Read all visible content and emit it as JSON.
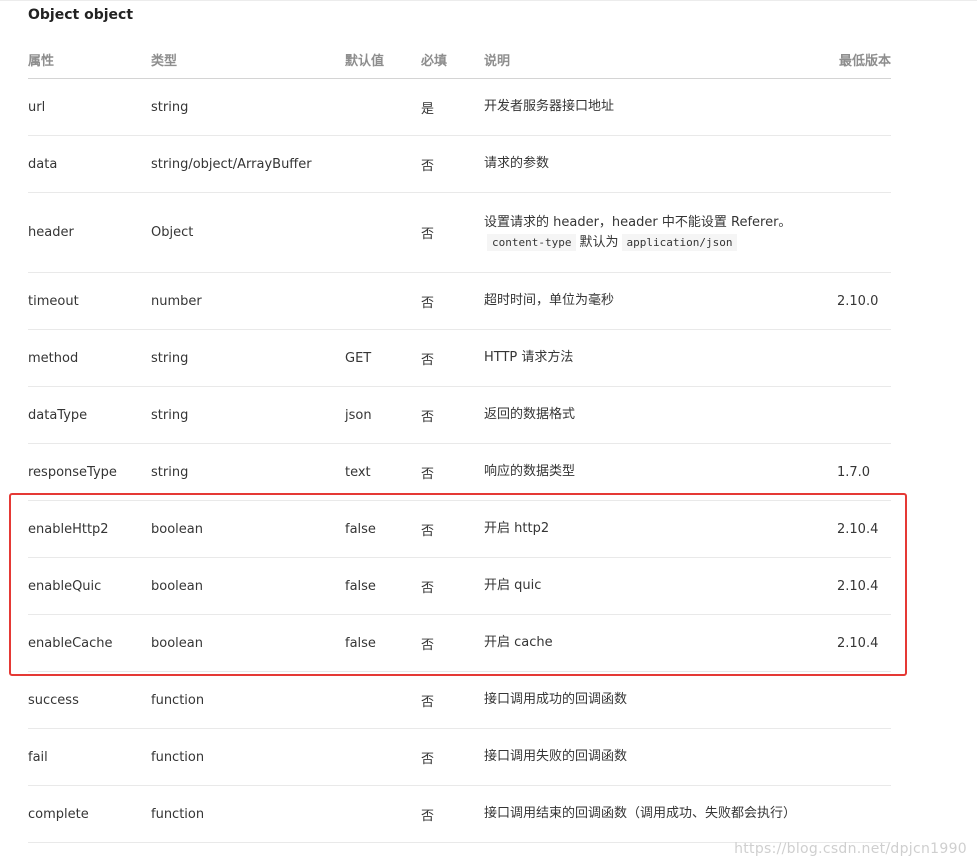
{
  "title": "Object object",
  "columns": [
    "属性",
    "类型",
    "默认值",
    "必填",
    "说明",
    "最低版本"
  ],
  "rows": [
    {
      "name": "url",
      "type": "string",
      "default": "",
      "required": "是",
      "desc": "开发者服务器接口地址",
      "version": ""
    },
    {
      "name": "data",
      "type": "string/object/ArrayBuffer",
      "default": "",
      "required": "否",
      "desc": "请求的参数",
      "version": ""
    },
    {
      "name": "header",
      "type": "Object",
      "default": "",
      "required": "否",
      "desc_line1": "设置请求的 header，header 中不能设置 Referer。",
      "desc_code1": "content-type",
      "desc_mid": "默认为",
      "desc_code2": "application/json",
      "version": ""
    },
    {
      "name": "timeout",
      "type": "number",
      "default": "",
      "required": "否",
      "desc": "超时时间，单位为毫秒",
      "version": "2.10.0"
    },
    {
      "name": "method",
      "type": "string",
      "default": "GET",
      "required": "否",
      "desc": "HTTP 请求方法",
      "version": ""
    },
    {
      "name": "dataType",
      "type": "string",
      "default": "json",
      "required": "否",
      "desc": "返回的数据格式",
      "version": ""
    },
    {
      "name": "responseType",
      "type": "string",
      "default": "text",
      "required": "否",
      "desc": "响应的数据类型",
      "version": "1.7.0"
    },
    {
      "name": "enableHttp2",
      "type": "boolean",
      "default": "false",
      "required": "否",
      "desc": "开启 http2",
      "version": "2.10.4"
    },
    {
      "name": "enableQuic",
      "type": "boolean",
      "default": "false",
      "required": "否",
      "desc": "开启 quic",
      "version": "2.10.4"
    },
    {
      "name": "enableCache",
      "type": "boolean",
      "default": "false",
      "required": "否",
      "desc": "开启 cache",
      "version": "2.10.4"
    },
    {
      "name": "success",
      "type": "function",
      "default": "",
      "required": "否",
      "desc": "接口调用成功的回调函数",
      "version": ""
    },
    {
      "name": "fail",
      "type": "function",
      "default": "",
      "required": "否",
      "desc": "接口调用失败的回调函数",
      "version": ""
    },
    {
      "name": "complete",
      "type": "function",
      "default": "",
      "required": "否",
      "desc": "接口调用结束的回调函数（调用成功、失败都会执行）",
      "version": ""
    }
  ],
  "highlight_color": "#e53935",
  "watermark": "https://blog.csdn.net/dpjcn1990"
}
